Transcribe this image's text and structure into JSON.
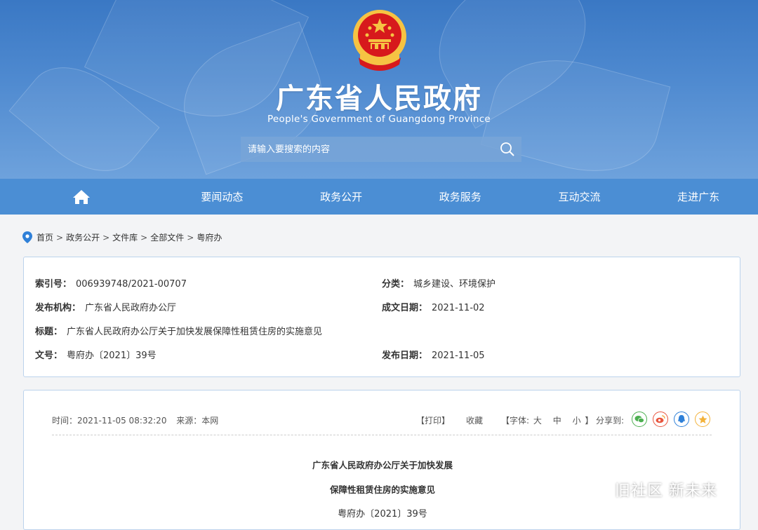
{
  "header": {
    "title": "广东省人民政府",
    "subtitle": "People's Government of Guangdong Province",
    "search_placeholder": "请输入要搜索的内容"
  },
  "nav": {
    "items": [
      {
        "label": "要闻动态"
      },
      {
        "label": "政务公开"
      },
      {
        "label": "政务服务"
      },
      {
        "label": "互动交流"
      },
      {
        "label": "走进广东"
      }
    ]
  },
  "breadcrumb": [
    "首页",
    "政务公开",
    "文件库",
    "全部文件",
    "粤府办"
  ],
  "meta": {
    "index_label": "索引号：",
    "index_value": "006939748/2021-00707",
    "category_label": "分类：",
    "category_value": "城乡建设、环境保护",
    "issuer_label": "发布机构：",
    "issuer_value": "广东省人民政府办公厅",
    "created_label": "成文日期：",
    "created_value": "2021-11-02",
    "title_label": "标题：",
    "title_value": "广东省人民政府办公厅关于加快发展保障性租赁住房的实施意见",
    "docno_label": "文号：",
    "docno_value": "粤府办〔2021〕39号",
    "published_label": "发布日期：",
    "published_value": "2021-11-05"
  },
  "toolbar": {
    "time": "时间：2021-11-05 08:32:20",
    "source": "来源：本网",
    "print": "【打印】",
    "favorite": "收藏",
    "font_prefix": "【字体:",
    "font_large": "大",
    "font_medium": "中",
    "font_small": "小",
    "font_suffix": "】",
    "share_label": "分享到:"
  },
  "document": {
    "title_line1": "广东省人民政府办公厅关于加快发展",
    "title_line2": "保障性租赁住房的实施意见",
    "number": "粤府办〔2021〕39号"
  },
  "watermark": "旧社区 新未来",
  "colors": {
    "nav_bg": "#4b8ed4",
    "header_bg": "#3a78c4",
    "box_border": "#bcd3ec",
    "emblem_red": "#d7191c",
    "emblem_gold": "#f6c343"
  },
  "icons": [
    "home-icon",
    "search-icon",
    "location-pin-icon",
    "wechat-icon",
    "weibo-icon",
    "qq-icon",
    "qzone-icon",
    "wechat-official-account-icon"
  ]
}
